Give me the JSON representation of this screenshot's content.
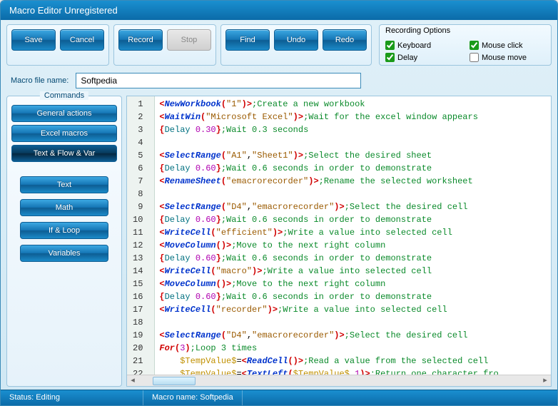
{
  "title": "Macro Editor Unregistered",
  "toolbar": {
    "save": "Save",
    "cancel": "Cancel",
    "record": "Record",
    "stop": "Stop",
    "find": "Find",
    "undo": "Undo",
    "redo": "Redo"
  },
  "recording": {
    "legend": "Recording Options",
    "keyboard": "Keyboard",
    "mouseclick": "Mouse click",
    "delay": "Delay",
    "mousemove": "Mouse move",
    "checked": {
      "keyboard": true,
      "mouseclick": true,
      "delay": true,
      "mousemove": false
    }
  },
  "file": {
    "label": "Macro file name:",
    "value": "Softpedia"
  },
  "commands": {
    "legend": "Commands",
    "groups": [
      "General actions",
      "Excel macros",
      "Text & Flow & Var"
    ],
    "activeGroup": 2,
    "sub": [
      "Text",
      "Math",
      "If & Loop",
      "Variables"
    ]
  },
  "code": {
    "lines": [
      {
        "n": 1,
        "html": "<span class='br'>&lt;</span><span class='kw2'>NewWorkbook</span><span class='br'>(</span><span class='str'>\"1\"</span><span class='br'>)&gt;</span><span class='cmt'>;Create a new workbook</span>"
      },
      {
        "n": 2,
        "html": "<span class='br'>&lt;</span><span class='kw2'>WaitWin</span><span class='br'>(</span><span class='str'>\"Microsoft Excel\"</span><span class='br'>)&gt;</span><span class='cmt'>;Wait for the excel window appears</span>"
      },
      {
        "n": 3,
        "html": "<span class='br'>{</span><span class='op'>Delay</span> <span class='num'>0.30</span><span class='br'>}</span><span class='cmt'>;Wait 0.3 seconds</span>"
      },
      {
        "n": 4,
        "html": ""
      },
      {
        "n": 5,
        "html": "<span class='br'>&lt;</span><span class='kw2'>SelectRange</span><span class='br'>(</span><span class='str'>\"A1\"</span>,<span class='str'>\"Sheet1\"</span><span class='br'>)&gt;</span><span class='cmt'>;Select the desired sheet</span>"
      },
      {
        "n": 6,
        "html": "<span class='br'>{</span><span class='op'>Delay</span> <span class='num'>0.60</span><span class='br'>}</span><span class='cmt'>;Wait 0.6 seconds in order to demonstrate</span>"
      },
      {
        "n": 7,
        "html": "<span class='br'>&lt;</span><span class='kw2'>RenameSheet</span><span class='br'>(</span><span class='str'>\"emacrorecorder\"</span><span class='br'>)&gt;</span><span class='cmt'>;Rename the selected worksheet</span>"
      },
      {
        "n": 8,
        "html": ""
      },
      {
        "n": 9,
        "html": "<span class='br'>&lt;</span><span class='kw2'>SelectRange</span><span class='br'>(</span><span class='str'>\"D4\"</span>,<span class='str'>\"emacrorecorder\"</span><span class='br'>)&gt;</span><span class='cmt'>;Select the desired cell</span>"
      },
      {
        "n": 10,
        "html": "<span class='br'>{</span><span class='op'>Delay</span> <span class='num'>0.60</span><span class='br'>}</span><span class='cmt'>;Wait 0.6 seconds in order to demonstrate</span>"
      },
      {
        "n": 11,
        "html": "<span class='br'>&lt;</span><span class='kw2'>WriteCell</span><span class='br'>(</span><span class='str'>\"efficient\"</span><span class='br'>)&gt;</span><span class='cmt'>;Write a value into selected cell</span>"
      },
      {
        "n": 12,
        "html": "<span class='br'>&lt;</span><span class='kw2'>MoveColumn</span><span class='br'>()&gt;</span><span class='cmt'>;Move to the next right column</span>"
      },
      {
        "n": 13,
        "html": "<span class='br'>{</span><span class='op'>Delay</span> <span class='num'>0.60</span><span class='br'>}</span><span class='cmt'>;Wait 0.6 seconds in order to demonstrate</span>"
      },
      {
        "n": 14,
        "html": "<span class='br'>&lt;</span><span class='kw2'>WriteCell</span><span class='br'>(</span><span class='str'>\"macro\"</span><span class='br'>)&gt;</span><span class='cmt'>;Write a value into selected cell</span>"
      },
      {
        "n": 15,
        "html": "<span class='br'>&lt;</span><span class='kw2'>MoveColumn</span><span class='br'>()&gt;</span><span class='cmt'>;Move to the next right column</span>"
      },
      {
        "n": 16,
        "html": "<span class='br'>{</span><span class='op'>Delay</span> <span class='num'>0.60</span><span class='br'>}</span><span class='cmt'>;Wait 0.6 seconds in order to demonstrate</span>"
      },
      {
        "n": 17,
        "html": "<span class='br'>&lt;</span><span class='kw2'>WriteCell</span><span class='br'>(</span><span class='str'>\"recorder\"</span><span class='br'>)&gt;</span><span class='cmt'>;Write a value into selected cell</span>"
      },
      {
        "n": 18,
        "html": ""
      },
      {
        "n": 19,
        "html": "<span class='br'>&lt;</span><span class='kw2'>SelectRange</span><span class='br'>(</span><span class='str'>\"D4\"</span>,<span class='str'>\"emacrorecorder\"</span><span class='br'>)&gt;</span><span class='cmt'>;Select the desired cell</span>"
      },
      {
        "n": 20,
        "fold": true,
        "html": "<span class='kw'>For</span><span class='br'>(</span><span class='num'>3</span><span class='br'>)</span><span class='cmt'>;Loop 3 times</span>"
      },
      {
        "n": 21,
        "indent": true,
        "html": "<span class='var'>$TempValue$</span>=<span class='br'>&lt;</span><span class='kw2'>ReadCell</span><span class='br'>()&gt;</span><span class='cmt'>;Read a value from the selected cell</span>"
      },
      {
        "n": 22,
        "indent": true,
        "html": "<span class='var'>$TempValue$</span>=<span class='br'>&lt;</span><span class='kw2'>TextLeft</span><span class='br'>(</span><span class='var'>$TempValue$</span>,<span class='num'>1</span><span class='br'>)&gt;</span><span class='cmt'>;Return one character fro</span>"
      }
    ]
  },
  "status": {
    "left": "Status: Editing",
    "right": "Macro name: Softpedia"
  }
}
